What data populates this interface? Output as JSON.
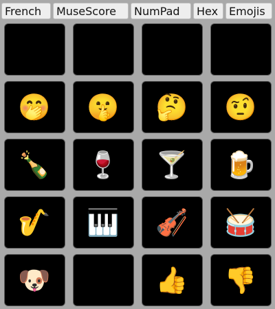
{
  "tabs": [
    "French",
    "MuseScore",
    "NumPad",
    "Hex",
    "Emojis"
  ],
  "active_tab": "Emojis",
  "keys": [
    {
      "emoji": "😃",
      "icon": "grinning-face-icon"
    },
    {
      "emoji": "😂",
      "icon": "tears-of-joy-icon"
    },
    {
      "emoji": "😟",
      "icon": "worried-face-icon"
    },
    {
      "emoji": "😉",
      "icon": "winking-face-icon"
    },
    {
      "emoji": "🤭",
      "icon": "hand-over-mouth-icon"
    },
    {
      "emoji": "🤫",
      "icon": "shushing-face-icon"
    },
    {
      "emoji": "🤔",
      "icon": "thinking-face-icon"
    },
    {
      "emoji": "🤨",
      "icon": "raised-eyebrow-icon"
    },
    {
      "emoji": "🍾",
      "icon": "champagne-bottle-icon"
    },
    {
      "emoji": "🍷",
      "icon": "wine-glass-icon"
    },
    {
      "emoji": "🍸",
      "icon": "cocktail-glass-icon"
    },
    {
      "emoji": "🍺",
      "icon": "beer-mug-icon"
    },
    {
      "emoji": "🎷",
      "icon": "saxophone-icon"
    },
    {
      "emoji": "🎹",
      "icon": "piano-keyboard-icon"
    },
    {
      "emoji": "🎻",
      "icon": "violin-icon"
    },
    {
      "emoji": "🥁",
      "icon": "drum-icon"
    },
    {
      "emoji": "🐶",
      "icon": "dog-face-icon"
    },
    {
      "emoji": "🐱",
      "icon": "cat-face-icon"
    },
    {
      "emoji": "👍",
      "icon": "thumbs-up-icon"
    },
    {
      "emoji": "👎",
      "icon": "thumbs-down-icon"
    }
  ]
}
